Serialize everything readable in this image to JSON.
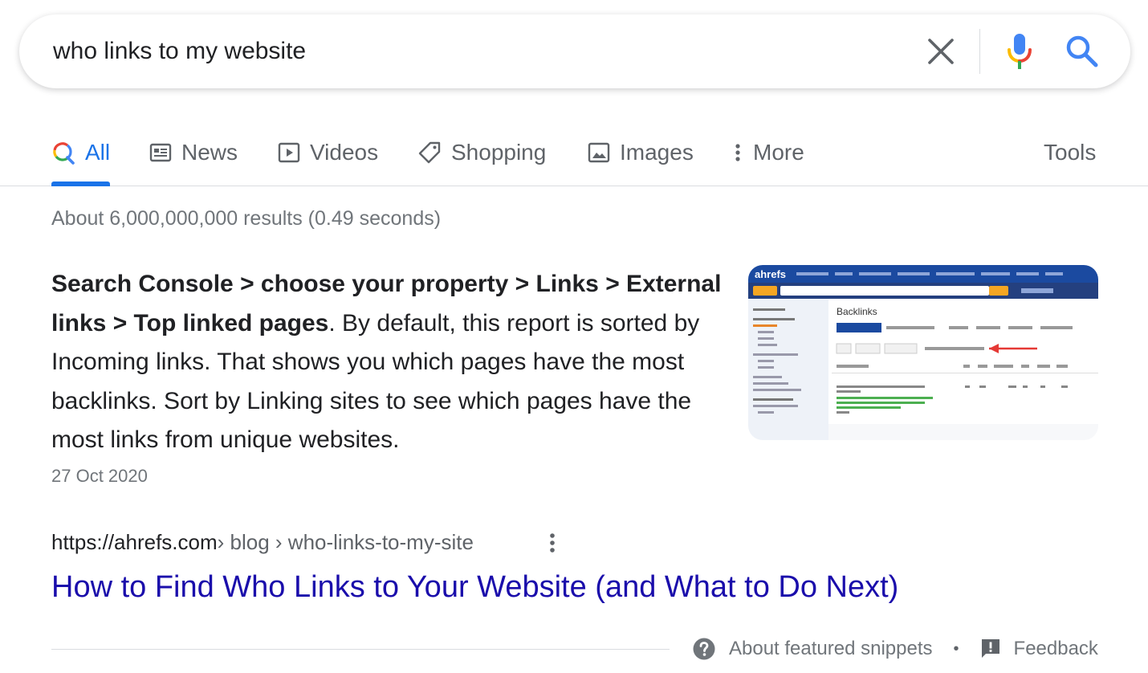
{
  "search": {
    "query": "who links to my website"
  },
  "tabs": [
    {
      "label": "All",
      "icon": "google-search-icon",
      "active": true
    },
    {
      "label": "News",
      "icon": "news-icon"
    },
    {
      "label": "Videos",
      "icon": "video-play-icon"
    },
    {
      "label": "Shopping",
      "icon": "tag-icon"
    },
    {
      "label": "Images",
      "icon": "image-icon"
    },
    {
      "label": "More",
      "icon": "vertical-dots-icon"
    }
  ],
  "tools_label": "Tools",
  "result_stats": "About 6,000,000,000 results (0.49 seconds)",
  "snippet": {
    "bold_part": "Search Console > choose your property > Links > External links > Top linked pages",
    "body": ". By default, this report is sorted by Incoming links. That shows you which pages have the most backlinks. Sort by Linking sites to see which pages have the most links from unique websites.",
    "date": "27 Oct 2020",
    "thumbnail": {
      "logo": "ahrefs",
      "heading": "Backlinks"
    }
  },
  "result": {
    "url_domain": "https://ahrefs.com",
    "url_path": " › blog › who-links-to-my-site",
    "title": "How to Find Who Links to Your Website (and What to Do Next)"
  },
  "footer": {
    "about_label": "About featured snippets",
    "separator": "•",
    "feedback_label": "Feedback"
  },
  "colors": {
    "link": "#1a0dab",
    "accent": "#1a73e8",
    "muted": "#70757a"
  }
}
